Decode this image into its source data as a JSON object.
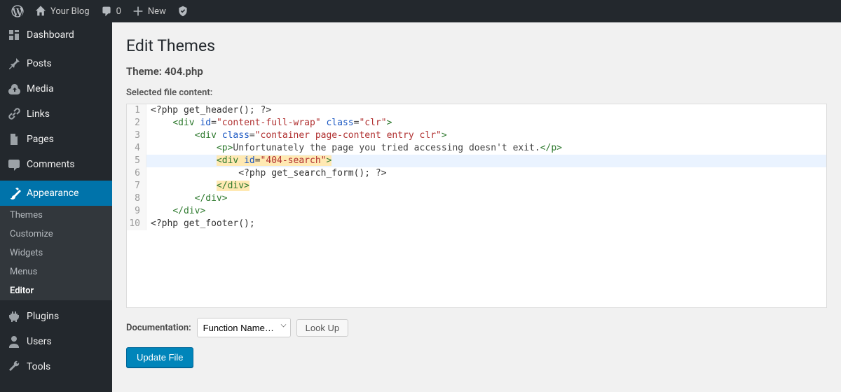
{
  "adminbar": {
    "site_name": "Your Blog",
    "comments_count": "0",
    "new_label": "New"
  },
  "sidebar": {
    "items": [
      {
        "label": "Dashboard"
      },
      {
        "label": "Posts"
      },
      {
        "label": "Media"
      },
      {
        "label": "Links"
      },
      {
        "label": "Pages"
      },
      {
        "label": "Comments"
      },
      {
        "label": "Appearance"
      },
      {
        "label": "Plugins"
      },
      {
        "label": "Users"
      },
      {
        "label": "Tools"
      }
    ],
    "appearance_submenu": [
      {
        "label": "Themes"
      },
      {
        "label": "Customize"
      },
      {
        "label": "Widgets"
      },
      {
        "label": "Menus"
      },
      {
        "label": "Editor"
      }
    ]
  },
  "page": {
    "title": "Edit Themes",
    "theme_label": "Theme: 404.php",
    "file_content_label": "Selected file content:",
    "doc_label": "Documentation:",
    "doc_select": "Function Name…",
    "lookup_btn": "Look Up",
    "update_btn": "Update File"
  },
  "code": {
    "lines": [
      {
        "n": "1"
      },
      {
        "n": "2"
      },
      {
        "n": "3"
      },
      {
        "n": "4"
      },
      {
        "n": "5"
      },
      {
        "n": "6"
      },
      {
        "n": "7"
      },
      {
        "n": "8"
      },
      {
        "n": "9"
      },
      {
        "n": "10"
      }
    ],
    "tokens": {
      "l1_php": "<?php get_header(); ?>",
      "l2_indent": "    ",
      "l2_t1": "<div ",
      "l2_a1": "id",
      "l2_eq": "=",
      "l2_s1": "\"content-full-wrap\"",
      "l2_sp": " ",
      "l2_a2": "class",
      "l2_s2": "\"clr\"",
      "l2_t2": ">",
      "l3_indent": "        ",
      "l3_t1": "<div ",
      "l3_a1": "class",
      "l3_s1": "\"container page-content entry clr\"",
      "l3_t2": ">",
      "l4_indent": "            ",
      "l4_t1": "<p>",
      "l4_text": "Unfortunately the page you tried accessing doesn't exit.",
      "l4_t2": "</p>",
      "l5_indent": "            ",
      "l5_t1": "<div ",
      "l5_a1": "id",
      "l5_s1": "\"404-search\"",
      "l5_t2": ">",
      "l6_indent": "                ",
      "l6_php": "<?php get_search_form(); ?>",
      "l7_indent": "            ",
      "l7_t1": "</div>",
      "l8_indent": "        ",
      "l8_t1": "</div>",
      "l9_indent": "    ",
      "l9_t1": "</div>",
      "l10_php": "<?php get_footer();"
    }
  }
}
